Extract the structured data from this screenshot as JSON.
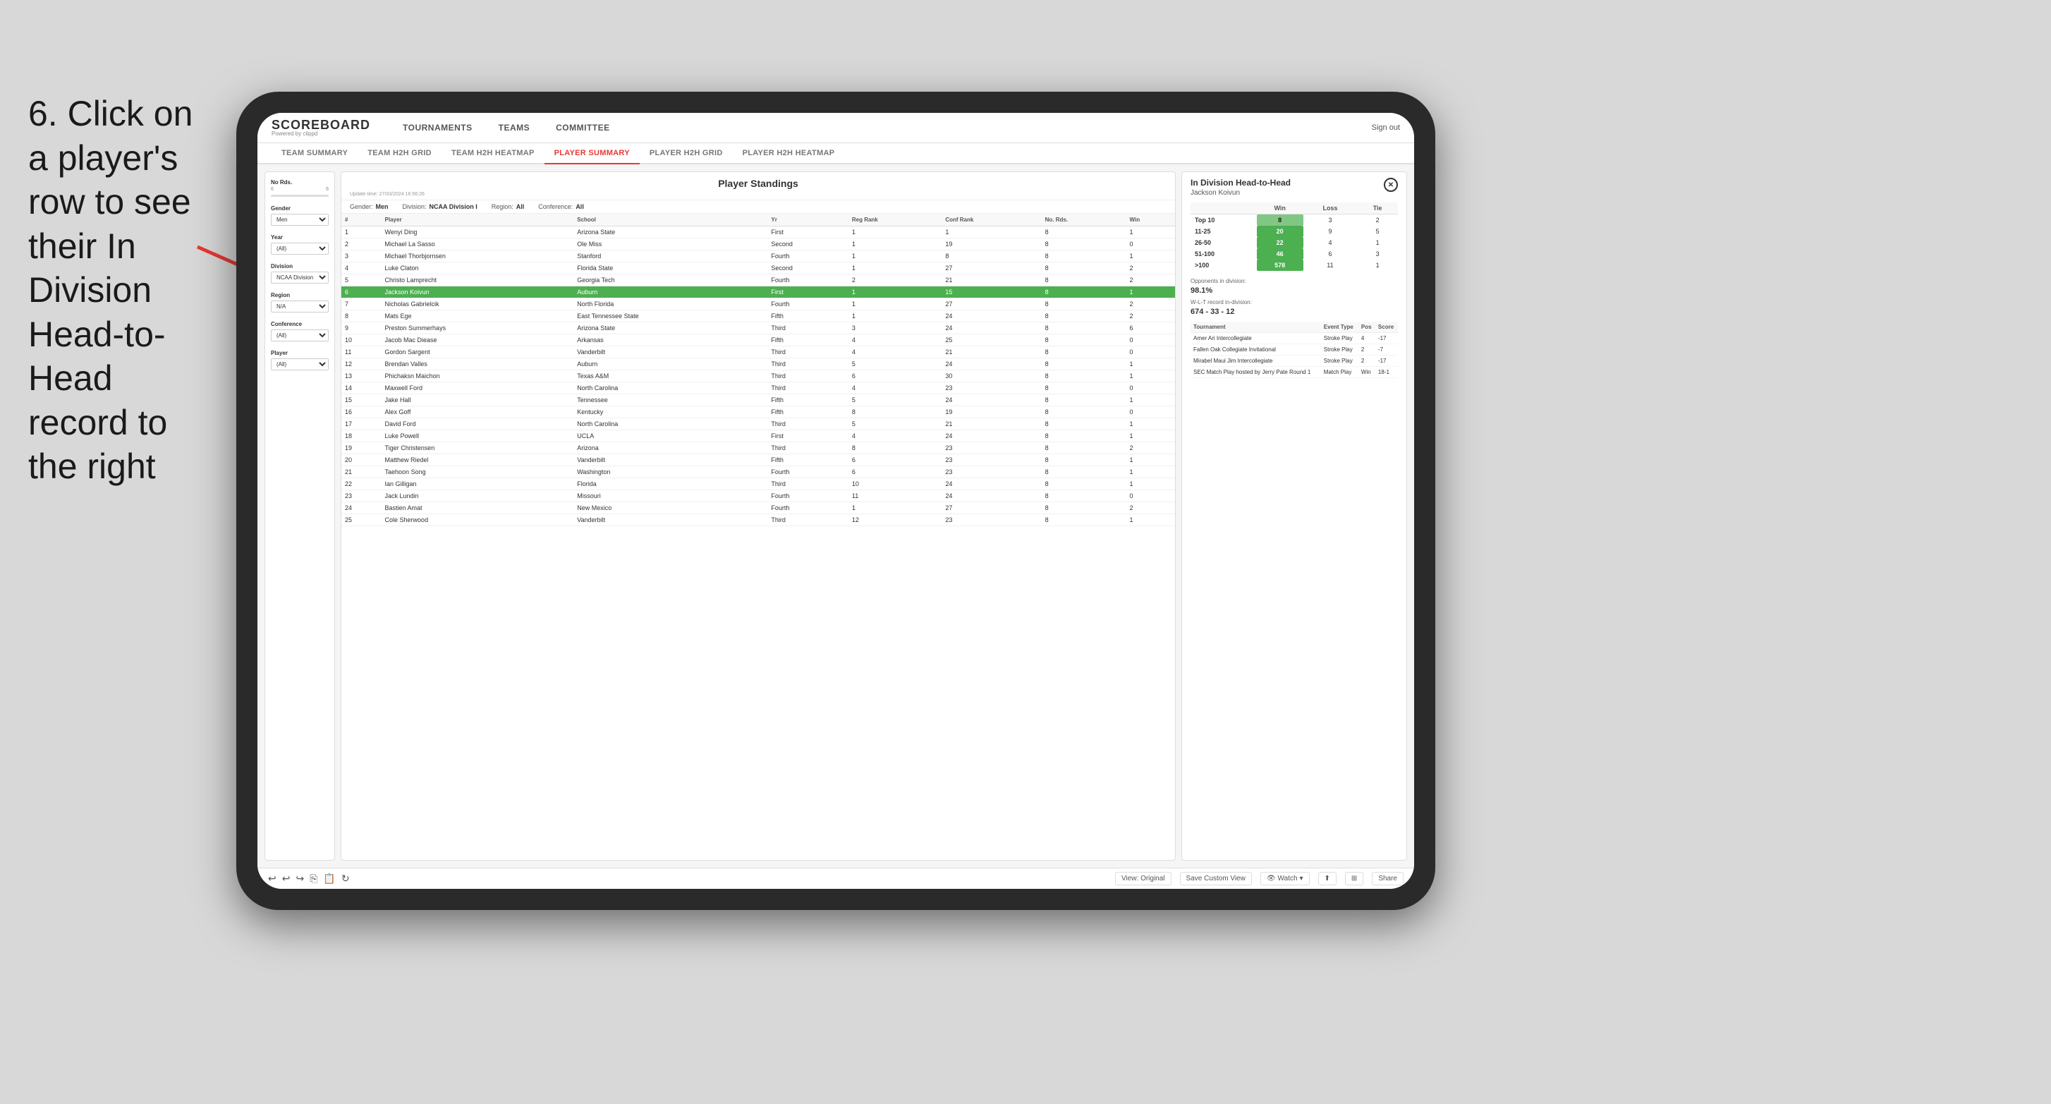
{
  "instruction": {
    "text": "6. Click on a player's row to see their In Division Head-to-Head record to the right"
  },
  "app": {
    "logo": {
      "main": "SCOREBOARD",
      "sub": "Powered by clippd"
    },
    "nav": {
      "tabs": [
        "TOURNAMENTS",
        "TEAMS",
        "COMMITTEE"
      ],
      "sign_out": "Sign out"
    },
    "sub_nav": {
      "tabs": [
        "TEAM SUMMARY",
        "TEAM H2H GRID",
        "TEAM H2H HEATMAP",
        "PLAYER SUMMARY",
        "PLAYER H2H GRID",
        "PLAYER H2H HEATMAP"
      ],
      "active": "PLAYER SUMMARY"
    }
  },
  "sidebar": {
    "no_rds": {
      "label": "No Rds.",
      "range_start": 6,
      "range_end": 6
    },
    "gender": {
      "label": "Gender",
      "value": "Men"
    },
    "year": {
      "label": "Year",
      "value": "(All)"
    },
    "division": {
      "label": "Division",
      "value": "NCAA Division I"
    },
    "region": {
      "label": "Region",
      "value": "N/A"
    },
    "conference": {
      "label": "Conference",
      "value": "(All)"
    },
    "player": {
      "label": "Player",
      "value": "(All)"
    }
  },
  "standings": {
    "title": "Player Standings",
    "update_time": "Update time: 27/03/2024 16:56:26",
    "filters": {
      "gender": "Men",
      "division": "NCAA Division I",
      "region": "All",
      "conference": "All"
    },
    "columns": [
      "#",
      "Player",
      "School",
      "Yr",
      "Reg Rank",
      "Conf Rank",
      "No. Rds.",
      "Win"
    ],
    "rows": [
      {
        "rank": 1,
        "player": "Wenyi Ding",
        "school": "Arizona State",
        "yr": "First",
        "reg": 1,
        "conf": 1,
        "rds": 8,
        "win": 1
      },
      {
        "rank": 2,
        "player": "Michael La Sasso",
        "school": "Ole Miss",
        "yr": "Second",
        "reg": 1,
        "conf": 19,
        "rds": 8,
        "win": 0
      },
      {
        "rank": 3,
        "player": "Michael Thorbjornsen",
        "school": "Stanford",
        "yr": "Fourth",
        "reg": 1,
        "conf": 8,
        "rds": 8,
        "win": 1
      },
      {
        "rank": 4,
        "player": "Luke Claton",
        "school": "Florida State",
        "yr": "Second",
        "reg": 1,
        "conf": 27,
        "rds": 8,
        "win": 2
      },
      {
        "rank": 5,
        "player": "Christo Lamprecht",
        "school": "Georgia Tech",
        "yr": "Fourth",
        "reg": 2,
        "conf": 21,
        "rds": 8,
        "win": 2
      },
      {
        "rank": 6,
        "player": "Jackson Koivun",
        "school": "Auburn",
        "yr": "First",
        "reg": 1,
        "conf": 15,
        "rds": 8,
        "win": 1,
        "highlighted": true
      },
      {
        "rank": 7,
        "player": "Nicholas Gabrielcik",
        "school": "North Florida",
        "yr": "Fourth",
        "reg": 1,
        "conf": 27,
        "rds": 8,
        "win": 2
      },
      {
        "rank": 8,
        "player": "Mats Ege",
        "school": "East Tennessee State",
        "yr": "Fifth",
        "reg": 1,
        "conf": 24,
        "rds": 8,
        "win": 2
      },
      {
        "rank": 9,
        "player": "Preston Summerhays",
        "school": "Arizona State",
        "yr": "Third",
        "reg": 3,
        "conf": 24,
        "rds": 8,
        "win": 6
      },
      {
        "rank": 10,
        "player": "Jacob Mac Diease",
        "school": "Arkansas",
        "yr": "Fifth",
        "reg": 4,
        "conf": 25,
        "rds": 8,
        "win": 0
      },
      {
        "rank": 11,
        "player": "Gordon Sargent",
        "school": "Vanderbilt",
        "yr": "Third",
        "reg": 4,
        "conf": 21,
        "rds": 8,
        "win": 0
      },
      {
        "rank": 12,
        "player": "Brendan Valles",
        "school": "Auburn",
        "yr": "Third",
        "reg": 5,
        "conf": 24,
        "rds": 8,
        "win": 1
      },
      {
        "rank": 13,
        "player": "Phichaksn Maichon",
        "school": "Texas A&M",
        "yr": "Third",
        "reg": 6,
        "conf": 30,
        "rds": 8,
        "win": 1
      },
      {
        "rank": 14,
        "player": "Maxwell Ford",
        "school": "North Carolina",
        "yr": "Third",
        "reg": 4,
        "conf": 23,
        "rds": 8,
        "win": 0
      },
      {
        "rank": 15,
        "player": "Jake Hall",
        "school": "Tennessee",
        "yr": "Fifth",
        "reg": 5,
        "conf": 24,
        "rds": 8,
        "win": 1
      },
      {
        "rank": 16,
        "player": "Alex Goff",
        "school": "Kentucky",
        "yr": "Fifth",
        "reg": 8,
        "conf": 19,
        "rds": 8,
        "win": 0
      },
      {
        "rank": 17,
        "player": "David Ford",
        "school": "North Carolina",
        "yr": "Third",
        "reg": 5,
        "conf": 21,
        "rds": 8,
        "win": 1
      },
      {
        "rank": 18,
        "player": "Luke Powell",
        "school": "UCLA",
        "yr": "First",
        "reg": 4,
        "conf": 24,
        "rds": 8,
        "win": 1
      },
      {
        "rank": 19,
        "player": "Tiger Christensen",
        "school": "Arizona",
        "yr": "Third",
        "reg": 8,
        "conf": 23,
        "rds": 8,
        "win": 2
      },
      {
        "rank": 20,
        "player": "Matthew Riedel",
        "school": "Vanderbilt",
        "yr": "Fifth",
        "reg": 6,
        "conf": 23,
        "rds": 8,
        "win": 1
      },
      {
        "rank": 21,
        "player": "Taehoon Song",
        "school": "Washington",
        "yr": "Fourth",
        "reg": 6,
        "conf": 23,
        "rds": 8,
        "win": 1
      },
      {
        "rank": 22,
        "player": "Ian Gilligan",
        "school": "Florida",
        "yr": "Third",
        "reg": 10,
        "conf": 24,
        "rds": 8,
        "win": 1
      },
      {
        "rank": 23,
        "player": "Jack Lundin",
        "school": "Missouri",
        "yr": "Fourth",
        "reg": 11,
        "conf": 24,
        "rds": 8,
        "win": 0
      },
      {
        "rank": 24,
        "player": "Bastien Amat",
        "school": "New Mexico",
        "yr": "Fourth",
        "reg": 1,
        "conf": 27,
        "rds": 8,
        "win": 2
      },
      {
        "rank": 25,
        "player": "Cole Sherwood",
        "school": "Vanderbilt",
        "yr": "Third",
        "reg": 12,
        "conf": 23,
        "rds": 8,
        "win": 1
      }
    ]
  },
  "h2h": {
    "title": "In Division Head-to-Head",
    "player": "Jackson Koivun",
    "table": {
      "headers": [
        "",
        "Win",
        "Loss",
        "Tie"
      ],
      "rows": [
        {
          "label": "Top 10",
          "win": 8,
          "loss": 3,
          "tie": 2,
          "win_class": "win-cell"
        },
        {
          "label": "11-25",
          "win": 20,
          "loss": 9,
          "tie": 5,
          "win_class": "win-cell-lg"
        },
        {
          "label": "26-50",
          "win": 22,
          "loss": 4,
          "tie": 1,
          "win_class": "win-cell-lg"
        },
        {
          "label": "51-100",
          "win": 46,
          "loss": 6,
          "tie": 3,
          "win_class": "win-cell-lg"
        },
        {
          "label": ">100",
          "win": 578,
          "loss": 11,
          "tie": 1,
          "win_class": "win-cell-lg"
        }
      ]
    },
    "opponents_pct": "98.1%",
    "wlt_record": "674 - 33 - 12",
    "wlt_label": "Opponents in division:",
    "record_label": "W-L-T record in-division:",
    "tournaments": {
      "headers": [
        "Tournament",
        "Event Type",
        "Pos",
        "Score"
      ],
      "rows": [
        {
          "tournament": "Amer Ari Intercollegiate",
          "event_type": "Stroke Play",
          "pos": 4,
          "score": "-17"
        },
        {
          "tournament": "Fallen Oak Collegiate Invitational",
          "event_type": "Stroke Play",
          "pos": 2,
          "score": "-7"
        },
        {
          "tournament": "Mirabel Maui Jim Intercollegiate",
          "event_type": "Stroke Play",
          "pos": 2,
          "score": "-17"
        },
        {
          "tournament": "SEC Match Play hosted by Jerry Pate Round 1",
          "event_type": "Match Play",
          "pos": "Win",
          "score": "18-1"
        }
      ]
    }
  },
  "toolbar": {
    "actions": [
      "View: Original",
      "Save Custom View"
    ],
    "right_actions": [
      "Watch",
      "Share"
    ]
  }
}
